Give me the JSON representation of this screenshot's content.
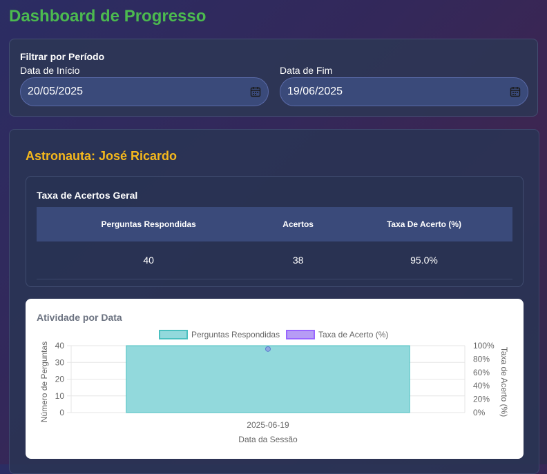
{
  "page": {
    "title": "Dashboard de Progresso"
  },
  "filter": {
    "title": "Filtrar por Período",
    "start_label": "Data de Início",
    "start_value": "20/05/2025",
    "end_label": "Data de Fim",
    "end_value": "19/06/2025",
    "icon": "calendar-icon"
  },
  "astronaut": {
    "heading": "Astronauta: José Ricardo"
  },
  "rate_card": {
    "title": "Taxa de Acertos Geral",
    "headers": [
      "Perguntas Respondidas",
      "Acertos",
      "Taxa De Acerto (%)"
    ],
    "row": [
      "40",
      "38",
      "95.0%"
    ]
  },
  "chart_title": "Atividade por Data",
  "chart_data": {
    "type": "bar",
    "categories": [
      "2025-06-19"
    ],
    "series": [
      {
        "name": "Perguntas Respondidas",
        "type": "bar",
        "axis": "left",
        "values": [
          40
        ],
        "color": "#92d9dc",
        "border": "#4bc0c0"
      },
      {
        "name": "Taxa de Acerto (%)",
        "type": "line",
        "axis": "right",
        "values": [
          95
        ],
        "color": "#b69cf5",
        "border": "#9966ff"
      }
    ],
    "xlabel": "Data da Sessão",
    "ylabel": "Número de Perguntas",
    "y2label": "Taxa de Acerto (%)",
    "ylim": [
      0,
      40
    ],
    "y2lim": [
      0,
      100
    ],
    "yticks": [
      "40",
      "30",
      "20",
      "10",
      "0"
    ],
    "y2ticks": [
      "100%",
      "80%",
      "60%",
      "40%",
      "20%",
      "0%"
    ],
    "grid": true,
    "legend": "top"
  }
}
